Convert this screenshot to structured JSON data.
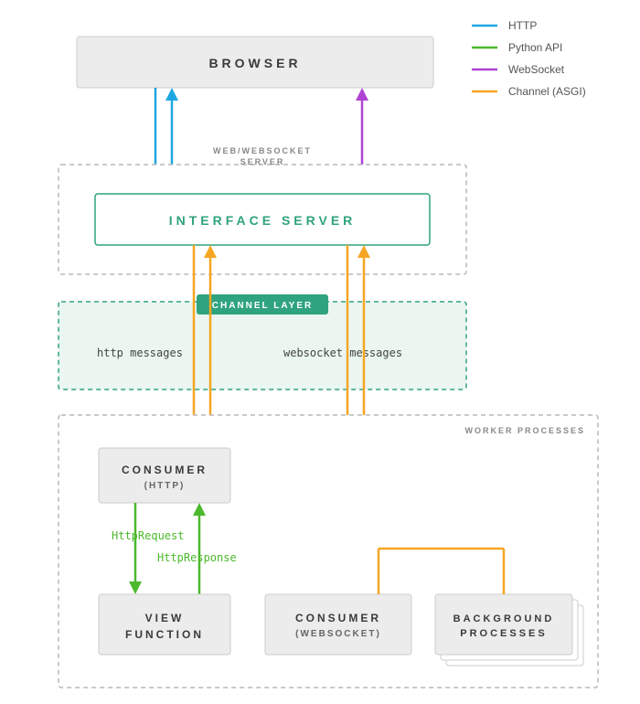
{
  "legend": [
    {
      "label": "HTTP",
      "color": "#1ea7e0"
    },
    {
      "label": "Python API",
      "color": "#4cb82c"
    },
    {
      "label": "WebSocket",
      "color": "#b045d4"
    },
    {
      "label": "Channel (ASGI)",
      "color": "#f5a623"
    }
  ],
  "boxes": {
    "browser": "BROWSER",
    "webserver_section": "WEB/WEBSOCKET\nSERVER",
    "interface_server": "INTERFACE SERVER",
    "channel_layer_tag": "CHANNEL LAYER",
    "http_messages": "http messages",
    "ws_messages": "websocket messages",
    "workers_section": "WORKER PROCESSES",
    "consumer_http": {
      "title": "CONSUMER",
      "sub": "(HTTP)"
    },
    "http_request": "HttpRequest",
    "http_response": "HttpResponse",
    "view_function": "VIEW\nFUNCTION",
    "consumer_ws": {
      "title": "CONSUMER",
      "sub": "(WEBSOCKET)"
    },
    "background": "BACKGROUND\nPROCESSES"
  },
  "chart_data": {
    "type": "diagram",
    "title": "Django Channels request flow",
    "nodes": [
      {
        "id": "browser",
        "label": "BROWSER"
      },
      {
        "id": "interface_server",
        "label": "INTERFACE SERVER",
        "group": "WEB/WEBSOCKET SERVER"
      },
      {
        "id": "channel_layer",
        "label": "CHANNEL LAYER"
      },
      {
        "id": "consumer_http",
        "label": "CONSUMER (HTTP)",
        "group": "WORKER PROCESSES"
      },
      {
        "id": "view_function",
        "label": "VIEW FUNCTION",
        "group": "WORKER PROCESSES"
      },
      {
        "id": "consumer_ws",
        "label": "CONSUMER (WEBSOCKET)",
        "group": "WORKER PROCESSES"
      },
      {
        "id": "background",
        "label": "BACKGROUND PROCESSES",
        "group": "WORKER PROCESSES"
      }
    ],
    "edges": [
      {
        "from": "browser",
        "to": "interface_server",
        "kind": "HTTP",
        "dir": "both"
      },
      {
        "from": "browser",
        "to": "interface_server",
        "kind": "WebSocket",
        "dir": "both"
      },
      {
        "from": "interface_server",
        "to": "consumer_http",
        "kind": "Channel (ASGI)",
        "dir": "both",
        "label": "http messages",
        "via": "channel_layer"
      },
      {
        "from": "interface_server",
        "to": "consumer_ws",
        "kind": "Channel (ASGI)",
        "dir": "both",
        "label": "websocket messages",
        "via": "channel_layer"
      },
      {
        "from": "consumer_http",
        "to": "view_function",
        "kind": "Python API",
        "dir": "forward",
        "label": "HttpRequest"
      },
      {
        "from": "view_function",
        "to": "consumer_http",
        "kind": "Python API",
        "dir": "forward",
        "label": "HttpResponse"
      },
      {
        "from": "background",
        "to": "consumer_ws",
        "kind": "Channel (ASGI)",
        "dir": "forward"
      }
    ],
    "legend": [
      "HTTP",
      "Python API",
      "WebSocket",
      "Channel (ASGI)"
    ]
  }
}
